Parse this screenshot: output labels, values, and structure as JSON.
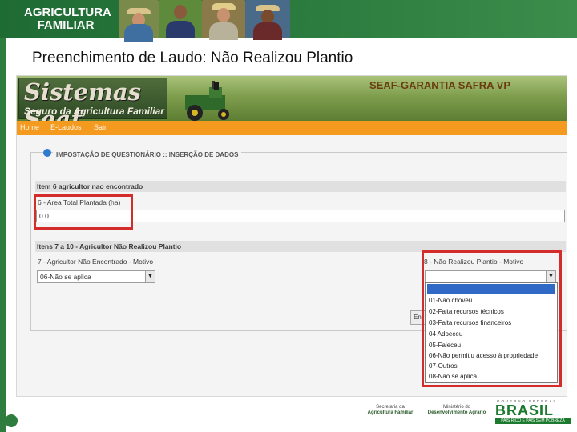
{
  "banner": {
    "title_line1": "AGRICULTURA",
    "title_line2": "FAMILIAR"
  },
  "slide": {
    "title": "Preenchimento de Laudo: Não Realizou Plantio"
  },
  "app": {
    "logo_main": "Sistemas Seaf",
    "logo_sub": "Seguro da Agricultura Familiar",
    "header_title": "SEAF-GARANTIA SAFRA VP",
    "nav": [
      "Home",
      "E-Laudos",
      "Sair"
    ],
    "panel_legend": "IMPOSTAÇÃO DE QUESTIONÁRIO :: INSERÇÃO DE DADOS",
    "section1_header": "Item 6 agricultor nao encontrado",
    "field6_label": "6 - Area Total Plantada (ha)",
    "field6_value": "0.0",
    "section2_header": "Itens 7 a 10 - Agricultor Não Realizou Plantio",
    "field7_label": "7 - Agricultor Não Encontrado - Motivo",
    "field7_value": "06-Não se aplica",
    "field8_label": "8 - Não Realizou Plantio - Motivo",
    "field8_value": "",
    "partial_button": "En",
    "dropdown_options": [
      "",
      "01-Não choveu",
      "02-Falta recursos técnicos",
      "03-Falta recursos financeiros",
      "04 Adoeceu",
      "05-Faleceu",
      "06-Não permitiu acesso à propriedade",
      "07-Outros",
      "08-Não se aplica"
    ]
  },
  "footer": {
    "secretaria_line1": "Secretaria da",
    "secretaria_line2": "Agricultura Familiar",
    "ministerio_line1": "Ministério do",
    "ministerio_line2": "Desenvolvimento Agrário",
    "brasil_top": "GOVERNO FEDERAL",
    "brasil": "BRASIL",
    "brasil_slogan": "PAÍS RICO É PAÍS SEM POBREZA"
  },
  "colors": {
    "banner_green": "#2c7c3f",
    "nav_orange": "#f39a1f",
    "highlight_red": "#d42b2b",
    "selection_blue": "#3169c6"
  }
}
